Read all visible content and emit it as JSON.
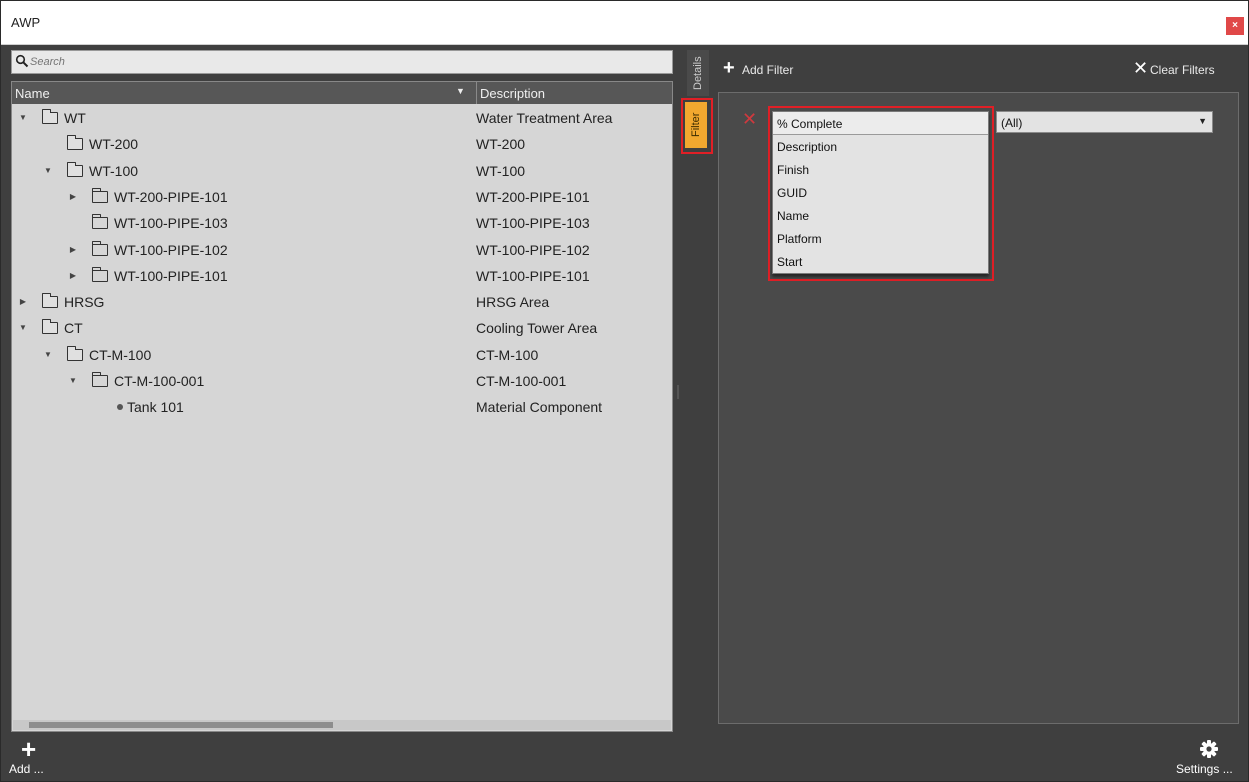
{
  "window": {
    "title": "AWP",
    "close_label": "×"
  },
  "search": {
    "placeholder": "Search"
  },
  "tree": {
    "columns": {
      "name": "Name",
      "description": "Description"
    },
    "rows": [
      {
        "name": "WT",
        "description": "Water Treatment Area",
        "level": 0,
        "expander": "expanded",
        "icon": "folder-filled"
      },
      {
        "name": "WT-200",
        "description": "WT-200",
        "level": 1,
        "expander": "none",
        "icon": "folder-filled"
      },
      {
        "name": "WT-100",
        "description": "WT-100",
        "level": 1,
        "expander": "expanded",
        "icon": "folder-filled"
      },
      {
        "name": "WT-200-PIPE-101",
        "description": "WT-200-PIPE-101",
        "level": 2,
        "expander": "collapsed",
        "icon": "folder-outline"
      },
      {
        "name": "WT-100-PIPE-103",
        "description": "WT-100-PIPE-103",
        "level": 2,
        "expander": "none",
        "icon": "folder-outline"
      },
      {
        "name": "WT-100-PIPE-102",
        "description": "WT-100-PIPE-102",
        "level": 2,
        "expander": "collapsed",
        "icon": "folder-outline"
      },
      {
        "name": "WT-100-PIPE-101",
        "description": "WT-100-PIPE-101",
        "level": 2,
        "expander": "collapsed",
        "icon": "folder-outline"
      },
      {
        "name": "HRSG",
        "description": "HRSG Area",
        "level": 0,
        "expander": "collapsed",
        "icon": "folder-filled"
      },
      {
        "name": "CT",
        "description": "Cooling Tower Area",
        "level": 0,
        "expander": "expanded",
        "icon": "folder-filled"
      },
      {
        "name": "CT-M-100",
        "description": "CT-M-100",
        "level": 1,
        "expander": "expanded",
        "icon": "folder-filled"
      },
      {
        "name": "CT-M-100-001",
        "description": "CT-M-100-001",
        "level": 2,
        "expander": "expanded",
        "icon": "folder-outline"
      },
      {
        "name": "Tank 101",
        "description": "Material Component",
        "level": 3,
        "expander": "none",
        "icon": "dot"
      }
    ]
  },
  "side_tabs": {
    "details": "Details",
    "filter": "Filter"
  },
  "filter_panel": {
    "add_filter_label": "Add Filter",
    "clear_filters_label": "Clear Filters",
    "field_dropdown": {
      "selected": "% Complete",
      "options": [
        "Description",
        "Finish",
        "GUID",
        "Name",
        "Platform",
        "Start"
      ]
    },
    "value_select": "(All)"
  },
  "bottom_bar": {
    "add_label": "Add ...",
    "settings_label": "Settings ..."
  },
  "colors": {
    "filter_tab": "#f2a82f",
    "highlight_outline": "#e01f26",
    "remove_x": "#d0393e"
  }
}
